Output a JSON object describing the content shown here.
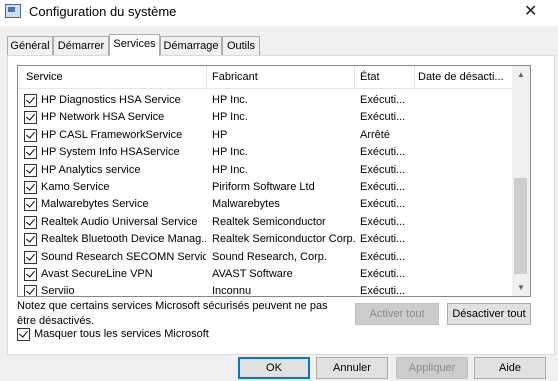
{
  "window": {
    "title": "Configuration du système",
    "close_icon": "close-icon"
  },
  "tabs": [
    {
      "label": "Général",
      "active": false
    },
    {
      "label": "Démarrer",
      "active": false
    },
    {
      "label": "Services",
      "active": true
    },
    {
      "label": "Démarrage",
      "active": false
    },
    {
      "label": "Outils",
      "active": false
    }
  ],
  "table": {
    "columns": [
      "Service",
      "Fabricant",
      "État",
      "Date de désacti..."
    ],
    "rows": [
      {
        "checked": true,
        "service": "HP Diagnostics HSA Service",
        "manufacturer": "HP Inc.",
        "state": "Exécuti..."
      },
      {
        "checked": true,
        "service": "HP Network HSA Service",
        "manufacturer": "HP Inc.",
        "state": "Exécuti..."
      },
      {
        "checked": true,
        "service": "HP CASL FrameworkService",
        "manufacturer": "HP",
        "state": "Arrêté"
      },
      {
        "checked": true,
        "service": "HP System Info HSAService",
        "manufacturer": "HP Inc.",
        "state": "Exécuti..."
      },
      {
        "checked": true,
        "service": "HP Analytics service",
        "manufacturer": "HP Inc.",
        "state": "Exécuti..."
      },
      {
        "checked": true,
        "service": "Kamo Service",
        "manufacturer": "Piriform Software Ltd",
        "state": "Exécuti..."
      },
      {
        "checked": true,
        "service": "Malwarebytes Service",
        "manufacturer": "Malwarebytes",
        "state": "Exécuti..."
      },
      {
        "checked": true,
        "service": "Realtek Audio Universal Service",
        "manufacturer": "Realtek Semiconductor",
        "state": "Exécuti..."
      },
      {
        "checked": true,
        "service": "Realtek Bluetooth Device Manag...",
        "manufacturer": "Realtek Semiconductor Corp.",
        "state": "Exécuti..."
      },
      {
        "checked": true,
        "service": "Sound Research SECOMN Service",
        "manufacturer": "Sound Research, Corp.",
        "state": "Exécuti..."
      },
      {
        "checked": true,
        "service": "Avast SecureLine VPN",
        "manufacturer": "AVAST Software",
        "state": "Exécuti..."
      },
      {
        "checked": true,
        "service": "Serviio",
        "manufacturer": "Inconnu",
        "state": "Exécuti..."
      }
    ]
  },
  "note": "Notez que certains services Microsoft sécurisés peuvent ne pas être désactivés.",
  "buttons": {
    "enable_all": "Activer tout",
    "disable_all": "Désactiver tout",
    "ok": "OK",
    "cancel": "Annuler",
    "apply": "Appliquer",
    "help": "Aide"
  },
  "hide_microsoft": {
    "checked": true,
    "label": "Masquer tous les services Microsoft"
  }
}
